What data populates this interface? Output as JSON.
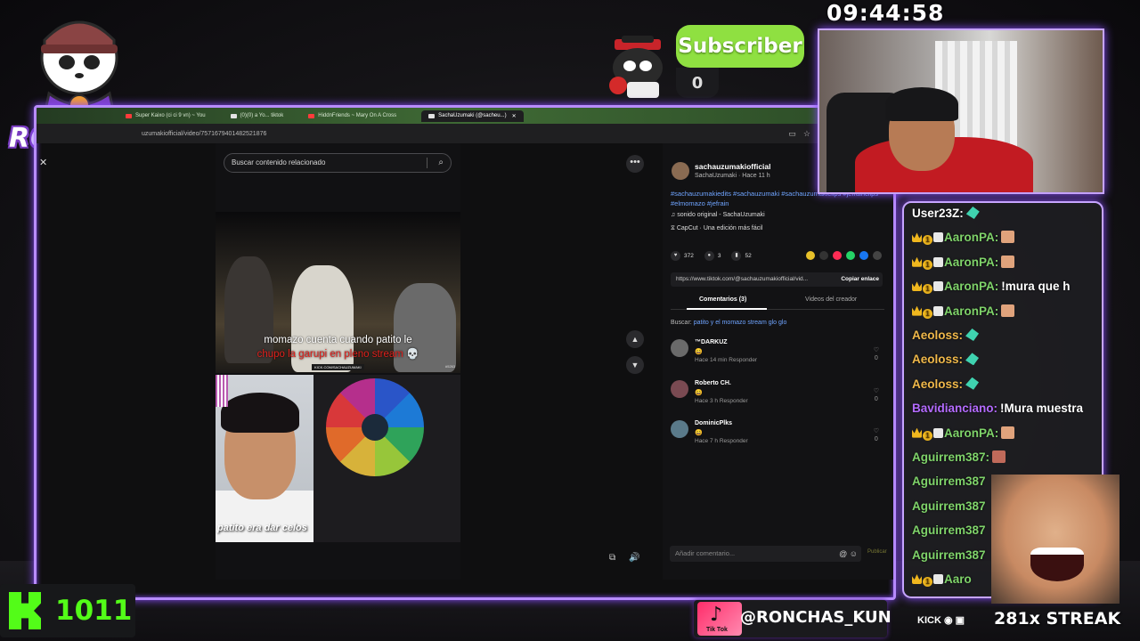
{
  "clock": "09:44:58",
  "logo": {
    "text": "RONCHAS"
  },
  "subscriber": {
    "label": "Subscriber",
    "count": "0"
  },
  "browser": {
    "tabs": [
      {
        "label": "Super Kaixo (ci ci 9 vn) ~ You",
        "color": "#ff3b3b"
      },
      {
        "label": "(0)(0) a Yo... tiktok",
        "color": "#e2e2e2"
      },
      {
        "label": "HiddnFriends ~ Mary On A Cross",
        "color": "#ff3b3b"
      },
      {
        "label": "SachaUzumaki (@sacheu...)",
        "color": "#e2e2e2",
        "active": true
      }
    ],
    "url": "uzumakiofficial/video/7571679401482521876"
  },
  "video": {
    "search_placeholder": "Buscar contenido relacionado",
    "caption_line1": "momazo cuenta cuando patito le",
    "caption_line2": "chupo la garupi en pleno stream 💀",
    "kick_tag": "KICK.COM/SACHAUZUMAKI",
    "tag_id": "#5263",
    "bottom_caption": "patito era dar celos"
  },
  "post": {
    "author": "sachauzumakiofficial",
    "author_sub": "SachaUzumaki · Hace 11 h",
    "hashtags": "#sachauzumakiedits #sachauzumaki #sachauzumakiclips #jefrainclips #elmomazo #jefrain",
    "music": "sonido original - SachaUzumaki",
    "capcut": "CapCut · Una edición más fácil",
    "likes": "372",
    "comments_count": "3",
    "saves": "52",
    "link": "https://www.tiktok.com/@sachauzumakiofficial/vid...",
    "copy_label": "Copiar enlace",
    "tab_comments": "Comentarios (3)",
    "tab_creator": "Videos del creador",
    "buscar_prefix": "Buscar:",
    "buscar_query": "patito y el momazo stream glo glo",
    "comments": [
      {
        "name": "™DARKUZ",
        "meta": "Hace 14 min    Responder",
        "likes": "0",
        "avatar_color": "#6a6a6a"
      },
      {
        "name": "Roberto CH.",
        "meta": "Hace 3 h    Responder",
        "likes": "0",
        "avatar_color": "#7a4a52"
      },
      {
        "name": "DominicPlks",
        "meta": "Hace 7 h    Responder",
        "likes": "0",
        "avatar_color": "#5a7a8a"
      }
    ],
    "comment_emoji": "😄",
    "input_placeholder": "Añadir comentario...",
    "publish": "Publicar"
  },
  "chat": [
    {
      "user": "User23Z:",
      "color": "#ffffff",
      "badges": [],
      "msg": "",
      "emote": "leaf"
    },
    {
      "user": "AaronPA:",
      "color": "#7fd36a",
      "badges": [
        "crown",
        "one",
        "tile"
      ],
      "msg": "",
      "emote": "face"
    },
    {
      "user": "AaronPA:",
      "color": "#7fd36a",
      "badges": [
        "crown",
        "one",
        "tile"
      ],
      "msg": "",
      "emote": "face"
    },
    {
      "user": "AaronPA:",
      "color": "#7fd36a",
      "badges": [
        "crown",
        "one",
        "tile"
      ],
      "msg": "!mura que h",
      "emote": ""
    },
    {
      "user": "AaronPA:",
      "color": "#7fd36a",
      "badges": [
        "crown",
        "one",
        "tile"
      ],
      "msg": "",
      "emote": "face"
    },
    {
      "user": "Aeoloss:",
      "color": "#f0b84a",
      "badges": [],
      "msg": "",
      "emote": "leaf"
    },
    {
      "user": "Aeoloss:",
      "color": "#f0b84a",
      "badges": [],
      "msg": "",
      "emote": "leaf"
    },
    {
      "user": "Aeoloss:",
      "color": "#f0b84a",
      "badges": [],
      "msg": "",
      "emote": "leaf"
    },
    {
      "user": "Bavidianciano:",
      "color": "#b46bff",
      "badges": [],
      "msg": "!Mura muestra",
      "emote": ""
    },
    {
      "user": "AaronPA:",
      "color": "#7fd36a",
      "badges": [
        "crown",
        "one",
        "tile"
      ],
      "msg": "",
      "emote": "face"
    },
    {
      "user": "Aguirrem387:",
      "color": "#7fd36a",
      "badges": [],
      "msg": "",
      "emote": "grin"
    },
    {
      "user": "Aguirrem387",
      "color": "#7fd36a",
      "badges": [],
      "msg": "",
      "emote": ""
    },
    {
      "user": "Aguirrem387",
      "color": "#7fd36a",
      "badges": [],
      "msg": "",
      "emote": ""
    },
    {
      "user": "Aguirrem387",
      "color": "#7fd36a",
      "badges": [],
      "msg": "",
      "emote": ""
    },
    {
      "user": "Aguirrem387",
      "color": "#7fd36a",
      "badges": [],
      "msg": "",
      "emote": ""
    },
    {
      "user": "Aaro",
      "color": "#7fd36a",
      "badges": [
        "crown",
        "one",
        "tile"
      ],
      "msg": "",
      "emote": ""
    }
  ],
  "kick": {
    "count": "1011"
  },
  "tiktok": {
    "label": "Tik Tok",
    "handle": "@RONCHAS_KUN"
  },
  "socials": "KICK",
  "streak": "281x STREAK"
}
